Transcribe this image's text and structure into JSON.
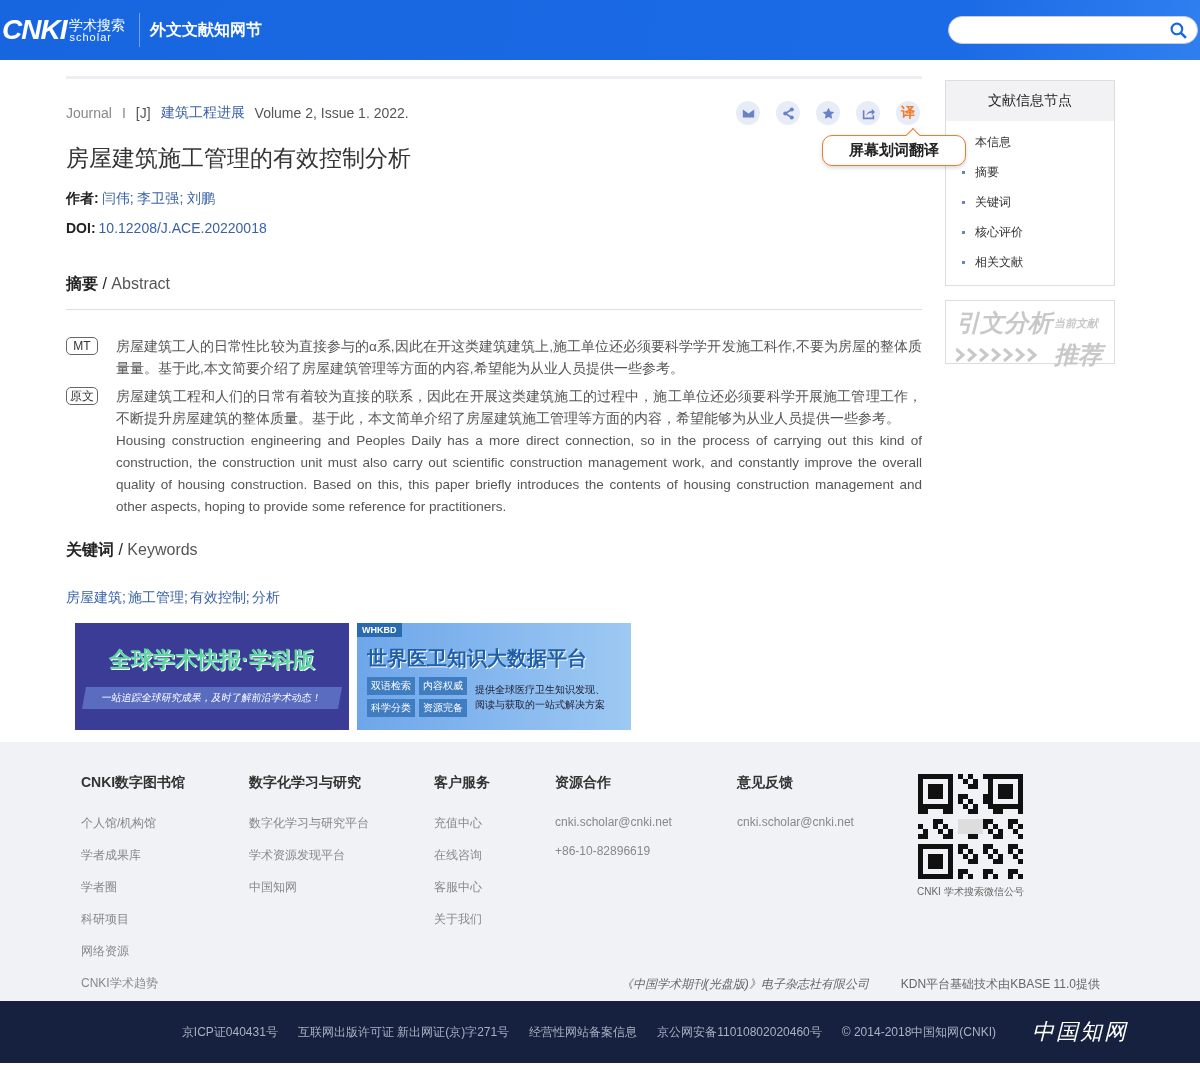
{
  "header": {
    "logo": {
      "mark": "CNKI",
      "cn": "学术搜索",
      "en": "scholar"
    },
    "site_title": "外文文献知网节"
  },
  "article": {
    "meta": {
      "type": "Journal",
      "sep": "I",
      "tag": "[J]",
      "journal": "建筑工程进展",
      "issue": "Volume 2, Issue 1. 2022."
    },
    "actions": [
      {
        "kind": "mail",
        "selected": false
      },
      {
        "kind": "share",
        "selected": false
      },
      {
        "kind": "star",
        "selected": false
      },
      {
        "kind": "export",
        "selected": false
      },
      {
        "kind": "translate",
        "label": "译",
        "selected": true
      }
    ],
    "tooltip": "屏幕划词翻译",
    "title": "房屋建筑施工管理的有效控制分析",
    "authors_label": "作者:",
    "authors": [
      "闫伟;",
      "李卫强;",
      "刘鹏"
    ],
    "doi_label": "DOI:",
    "doi": "10.12208/J.ACE.20220018",
    "abstract_heading": {
      "cn": "摘要",
      "sep": "/",
      "en": "Abstract"
    },
    "abstracts": [
      {
        "tag": "MT",
        "paragraphs": [
          "房屋建筑工人的日常性比较为直接参与的α系,因此在开这类建筑建筑上,施工单位还必须要科学学开发施工科作,不要为房屋的整体质量量。基于此,本文简要介绍了房屋建筑管理等方面的内容,希望能为从业人员提供一些参考。"
        ]
      },
      {
        "tag": "原文",
        "paragraphs": [
          "房屋建筑工程和人们的日常有着较为直接的联系，因此在开展这类建筑施工的过程中，施工单位还必须要科学开展施工管理工作，不断提升房屋建筑的整体质量。基于此，本文简单介绍了房屋建筑施工管理等方面的内容，希望能够为从业人员提供一些参考。",
          "Housing construction engineering and Peoples Daily has a more direct connection, so in the process of carrying out this kind of construction, the construction unit must also carry out scientific construction management work, and constantly improve the overall quality of housing construction. Based on this, this paper briefly introduces the contents of housing construction management and other aspects, hoping to provide some reference for practitioners."
        ]
      }
    ],
    "keywords_heading": {
      "cn": "关键词",
      "sep": "/",
      "en": "Keywords"
    },
    "keywords": [
      "房屋建筑;",
      "施工管理;",
      "有效控制;",
      "分析"
    ],
    "banners": [
      {
        "kind": "academic",
        "title": "全球学术快报·学科版",
        "subtitle": "一站追踪全球研究成果，及时了解前沿学术动态！"
      },
      {
        "kind": "medical",
        "badge": "WHKBD",
        "title": "世界医卫知识大数据平台",
        "tags": [
          "双语检索",
          "内容权威",
          "科学分类",
          "资源完备"
        ],
        "description": [
          "提供全球医疗卫生知识发现、",
          "阅读与获取的一站式解决方案"
        ]
      }
    ]
  },
  "sidebar": {
    "heading": "文献信息节点",
    "items": [
      "本信息",
      "摘要",
      "关键词",
      "核心评价",
      "相关文献"
    ],
    "citation_card": {
      "title": "引文分析",
      "corner": "当前文献",
      "action": "推荐"
    }
  },
  "footer": {
    "columns": [
      {
        "heading": "CNKI数字图书馆",
        "items": [
          "个人馆/机构馆",
          "学者成果库",
          "学者圈",
          "科研项目",
          "网络资源",
          "CNKI学术趋势"
        ]
      },
      {
        "heading": "数字化学习与研究",
        "items": [
          "数字化学习与研究平台",
          "学术资源发现平台",
          "中国知网"
        ]
      },
      {
        "heading": "客户服务",
        "items": [
          "充值中心",
          "在线咨询",
          "客服中心",
          "关于我们"
        ]
      },
      {
        "heading": "资源合作",
        "items": [
          "cnki.scholar@cnki.net",
          "+86-10-82896619"
        ]
      },
      {
        "heading": "意见反馈",
        "items": [
          "cnki.scholar@cnki.net"
        ]
      }
    ],
    "qr_caption": "CNKI 学术搜索微信公号",
    "publisher": "《中国学术期刊(光盘版)》电子杂志社有限公司",
    "tech": "KDN平台基础技术由KBASE 11.0提供",
    "legal": [
      "京ICP证040431号",
      "互联网出版许可证 新出网证(京)字271号",
      "经营性网站备案信息",
      "京公网安备11010802020460号",
      "© 2014-2018中国知网(CNKI)"
    ],
    "brand": "中国知网"
  }
}
